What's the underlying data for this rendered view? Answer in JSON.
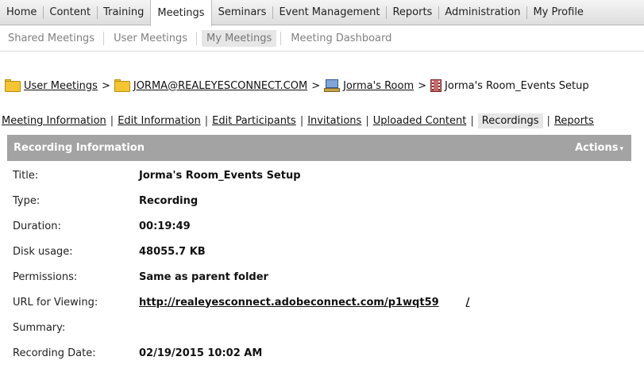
{
  "topnav": {
    "tabs": [
      {
        "label": "Home",
        "active": false
      },
      {
        "label": "Content",
        "active": false
      },
      {
        "label": "Training",
        "active": false
      },
      {
        "label": "Meetings",
        "active": true
      },
      {
        "label": "Seminars",
        "active": false
      },
      {
        "label": "Event Management",
        "active": false
      },
      {
        "label": "Reports",
        "active": false
      },
      {
        "label": "Administration",
        "active": false
      },
      {
        "label": "My Profile",
        "active": false
      }
    ]
  },
  "subnav": {
    "items": [
      {
        "label": "Shared Meetings",
        "active": false
      },
      {
        "label": "User Meetings",
        "active": false
      },
      {
        "label": "My Meetings",
        "active": true
      },
      {
        "label": "Meeting Dashboard",
        "active": false
      }
    ]
  },
  "breadcrumb": {
    "items": [
      {
        "label": "User Meetings",
        "icon": "folder-icon"
      },
      {
        "label": "JORMA@REALEYESCONNECT.COM",
        "icon": "folder-icon"
      },
      {
        "label": "Jorma's Room",
        "icon": "meeting-room-icon"
      },
      {
        "label": "Jorma's Room_Events Setup",
        "icon": "recording-icon"
      }
    ],
    "separator": ">"
  },
  "meeting_tabs": {
    "items": [
      {
        "label": "Meeting Information",
        "active": false
      },
      {
        "label": "Edit Information",
        "active": false
      },
      {
        "label": "Edit Participants",
        "active": false
      },
      {
        "label": "Invitations",
        "active": false
      },
      {
        "label": "Uploaded Content",
        "active": false
      },
      {
        "label": "Recordings",
        "active": true
      },
      {
        "label": "Reports",
        "active": false
      }
    ],
    "separator": "|"
  },
  "panel": {
    "title": "Recording Information",
    "actions_label": "Actions",
    "actions_caret": "▾"
  },
  "recording": {
    "title_label": "Title:",
    "title_value": "Jorma's Room_Events Setup",
    "type_label": "Type:",
    "type_value": "Recording",
    "duration_label": "Duration:",
    "duration_value": "00:19:49",
    "disk_label": "Disk usage:",
    "disk_value": "48055.7 KB",
    "permissions_label": "Permissions:",
    "permissions_value": "Same as parent folder",
    "url_label": "URL for Viewing:",
    "url_value": "http://realeyesconnect.adobeconnect.com/p1wqt59",
    "url_trailing": "/",
    "summary_label": "Summary:",
    "summary_value": "",
    "date_label": "Recording Date:",
    "date_value": "02/19/2015 10:02 AM"
  },
  "colors": {
    "panel_header_bg": "#a3a3a3",
    "active_tab_bg": "#e6e6e6",
    "folder_yellow": "#f4c431"
  }
}
